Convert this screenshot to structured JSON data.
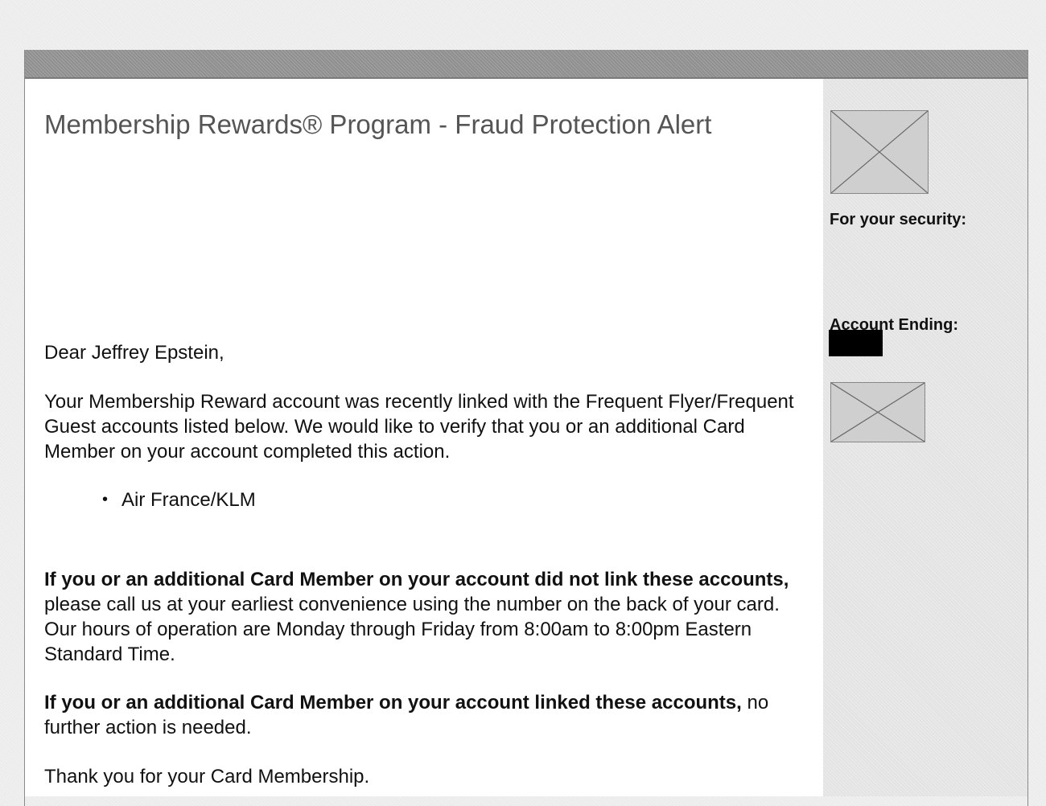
{
  "email": {
    "title": "Membership Rewards® Program - Fraud Protection Alert",
    "greeting": "Dear Jeffrey Epstein,",
    "intro": "Your Membership Reward account was recently linked with the Frequent Flyer/Frequent Guest accounts listed below. We would like to verify that you or an additional Card Member on your account completed this action.",
    "linked_accounts": [
      "Air France/KLM"
    ],
    "not_linked_bold": "If you or an additional Card Member on your account did not link these accounts,",
    "not_linked_text": " please call us at your earliest convenience using the number on the back of your card. Our hours of operation are Monday through Friday from 8:00am to 8:00pm Eastern Standard Time.",
    "linked_bold": "If you or an additional Card Member on your account linked these accounts,",
    "linked_text": " no further action is needed.",
    "closing": "Thank you for your Card Membership."
  },
  "sidebar": {
    "security_label": "For your security:",
    "account_label": "Account Ending:"
  },
  "colors": {
    "top_bar": "#8f8f8f",
    "sidebar_bg": "#e3e3e3",
    "title_text": "#555555",
    "redaction": "#000000"
  },
  "icons": {
    "top_image": "broken-image-icon",
    "bottom_image": "broken-image-icon"
  }
}
